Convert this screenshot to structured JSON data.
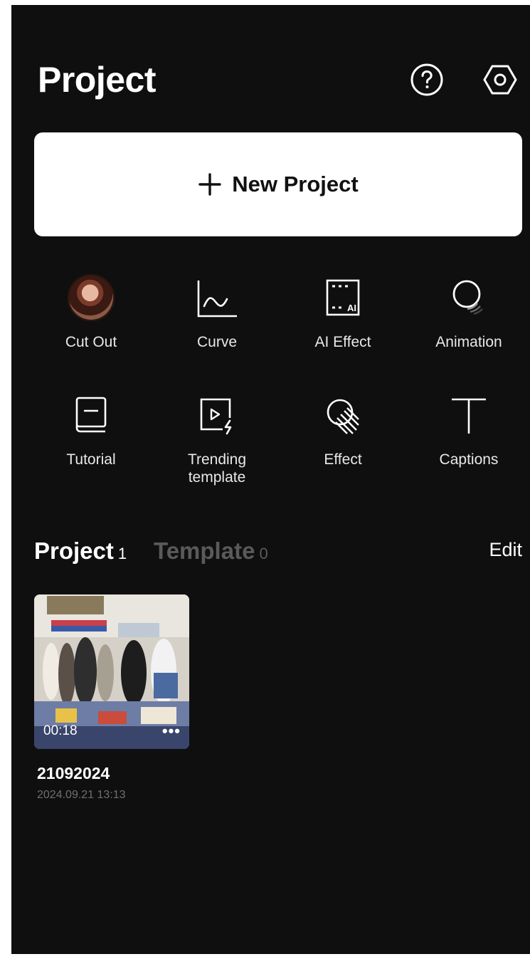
{
  "header": {
    "title": "Project",
    "help_icon": "help-circle-icon",
    "settings_icon": "hexagon-settings-icon"
  },
  "new_project": {
    "label": "New Project",
    "icon": "plus-icon"
  },
  "tools": [
    {
      "label": "Cut Out",
      "icon": "cutout-avatar-icon"
    },
    {
      "label": "Curve",
      "icon": "curve-graph-icon"
    },
    {
      "label": "AI Effect",
      "icon": "ai-effect-icon"
    },
    {
      "label": "Animation",
      "icon": "animation-circles-icon"
    },
    {
      "label": "Tutorial",
      "icon": "tutorial-book-icon"
    },
    {
      "label": "Trending\ntemplate",
      "icon": "trending-template-icon"
    },
    {
      "label": "Effect",
      "icon": "effect-sparkle-icon"
    },
    {
      "label": "Captions",
      "icon": "captions-text-icon"
    }
  ],
  "tabs": {
    "project_label": "Project",
    "project_count": "1",
    "template_label": "Template",
    "template_count": "0",
    "edit_label": "Edit"
  },
  "projects": [
    {
      "name": "21092024",
      "date": "2024.09.21 13:13",
      "duration": "00:18",
      "more": "•••"
    }
  ]
}
